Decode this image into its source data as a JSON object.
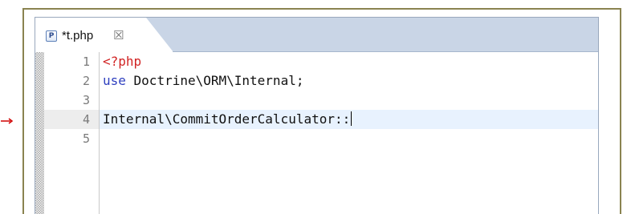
{
  "editor": {
    "tab": {
      "icon_letter": "P",
      "title": "*t.php",
      "close_glyph": "☒",
      "icon_name": "php-file-icon",
      "close_icon_name": "close-icon"
    },
    "line_numbers": [
      "1",
      "2",
      "3",
      "4",
      "5"
    ],
    "current_line": 4,
    "code": {
      "line1": {
        "php_open": "<?php"
      },
      "line2": {
        "keyword": "use",
        "namespace": " Doctrine\\ORM\\Internal",
        "semicolon": ";"
      },
      "line3": {
        "text": ""
      },
      "line4": {
        "class_ref": "Internal\\CommitOrderCalculator::"
      },
      "line5": {
        "text": ""
      }
    }
  },
  "colors": {
    "frame": "#8a8350",
    "tabbar": "#c9d5e6",
    "php_tag": "#d12323",
    "keyword": "#2e3fbf",
    "current_line": "#e8f2fe",
    "arrow": "#d00000"
  }
}
